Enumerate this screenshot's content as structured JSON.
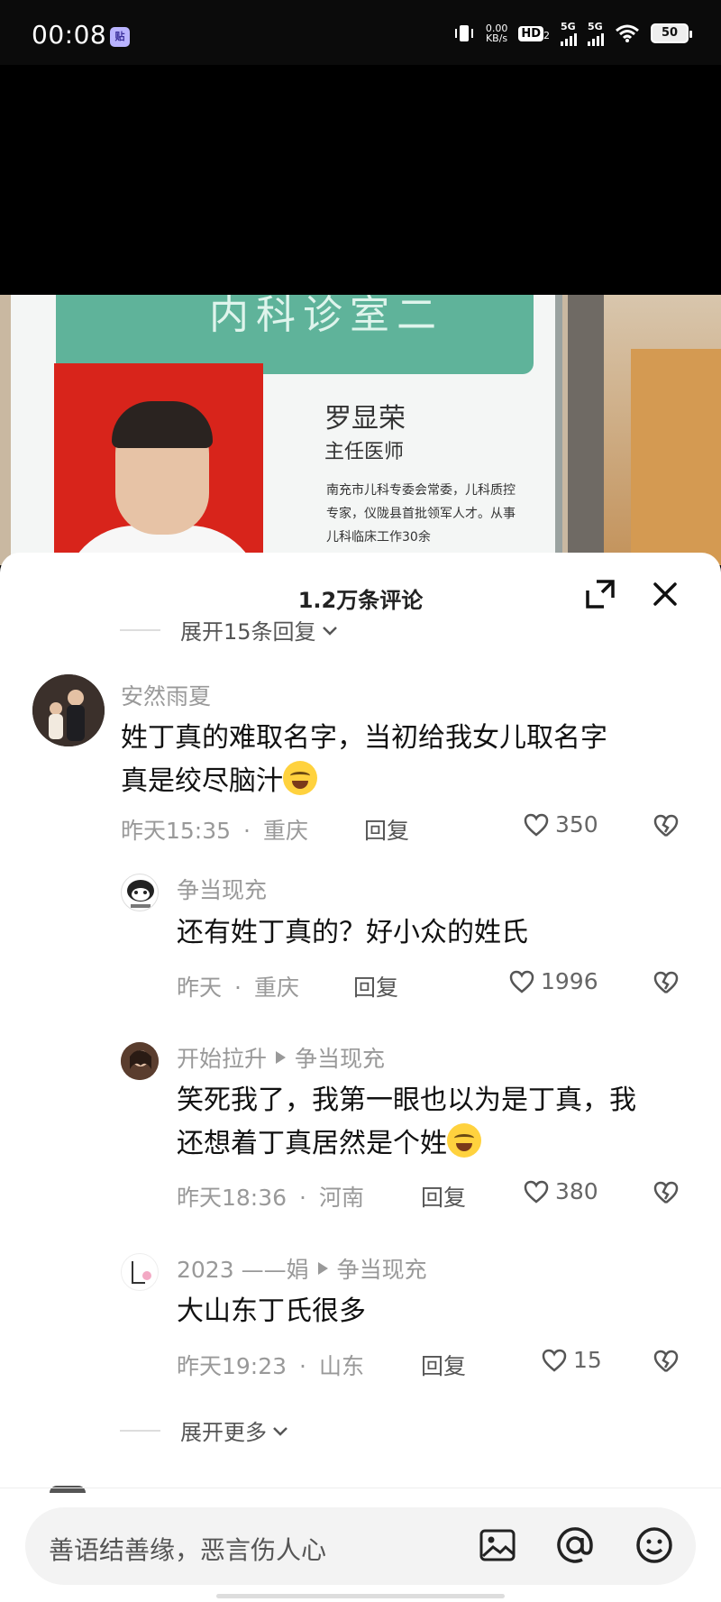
{
  "status_bar": {
    "time": "00:08",
    "app_icon": "贴",
    "net_speed_value": "0.00",
    "net_speed_unit": "KB/s",
    "hd": "HD",
    "hd_sub": "2",
    "sig1_label": "5G",
    "sig2_label": "5G",
    "battery": "50"
  },
  "video": {
    "board_header_text": "内科诊室二",
    "doctor_name": "罗显荣",
    "doctor_title": "主任医师",
    "doctor_desc": "南充市儿科专委会常委，儿科质控专家，仪陇县首批领军人才。从事儿科临床工作30余"
  },
  "sheet": {
    "title": "1.2万条评论",
    "expand_top_label": "展开15条回复",
    "expand_more_label": "展开更多",
    "input_placeholder": "善语结善缘，恶言伤人心"
  },
  "comments": [
    {
      "user": "安然雨夏",
      "text_line1": "姓丁真的难取名字，当初给我女儿取名字",
      "text_line2": "真是绞尽脑汁",
      "time": "昨天15:35",
      "location": "重庆",
      "reply": "回复",
      "likes": "350"
    },
    {
      "user": "争当现充",
      "text_line1": "还有姓丁真的？好小众的姓氏",
      "time": "昨天",
      "location": "重庆",
      "reply": "回复",
      "likes": "1996"
    },
    {
      "user": "开始拉升",
      "reply_to": "争当现充",
      "text_line1": "笑死我了，我第一眼也以为是丁真，我",
      "text_line2": "还想着丁真居然是个姓",
      "time": "昨天18:36",
      "location": "河南",
      "reply": "回复",
      "likes": "380"
    },
    {
      "user": "2023 ——娟",
      "reply_to": "争当现充",
      "text_line1": "大山东丁氏很多",
      "time": "昨天19:23",
      "location": "山东",
      "reply": "回复",
      "likes": "15"
    }
  ],
  "meta_separator": "·",
  "icons": {
    "expand": "expand-icon",
    "close": "close-icon",
    "chevron": "chevron-down-icon",
    "like": "heart-icon",
    "dislike": "broken-heart-icon",
    "image": "image-icon",
    "mention": "at-icon",
    "emoji": "emoji-icon"
  },
  "colors": {
    "accent_header": "#5fb39a",
    "portrait_bg": "#d8241b",
    "meta_gray": "#999999"
  }
}
